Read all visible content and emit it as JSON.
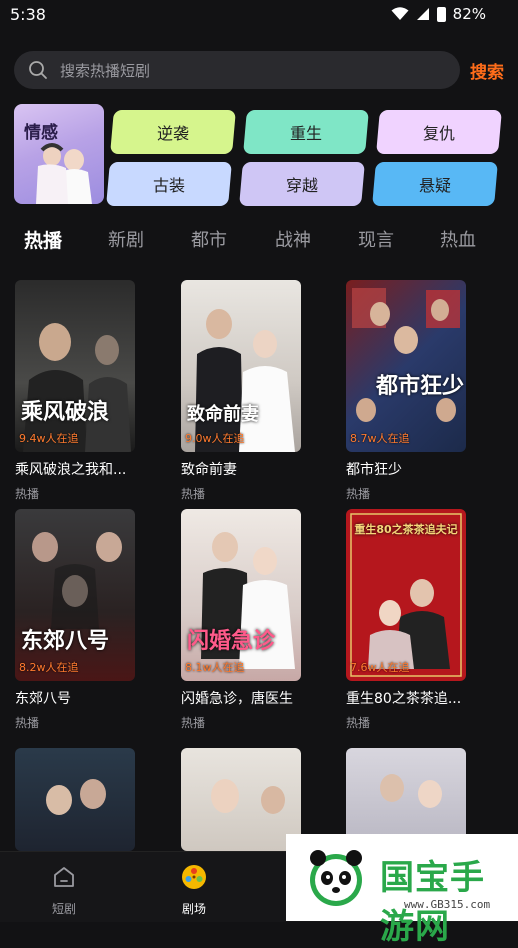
{
  "status_bar": {
    "time": "5:38",
    "battery": "82%"
  },
  "search": {
    "placeholder": "搜索热播短剧",
    "button_label": "搜索"
  },
  "featured": {
    "label": "情感"
  },
  "genres": [
    "逆袭",
    "重生",
    "复仇",
    "古装",
    "穿越",
    "悬疑"
  ],
  "genre_colors": [
    "#d6f58d",
    "#7fe6c6",
    "#f0d3ff",
    "#c8d9ff",
    "#cfc6f5",
    "#58b8f5"
  ],
  "tabs": [
    "热播",
    "新剧",
    "都市",
    "战神",
    "现言",
    "热血"
  ],
  "active_tab": "热播",
  "dramas": [
    {
      "title": "乘风破浪之我和...",
      "tag": "热播",
      "followers": "9.4w人在追",
      "poster_text": "乘风破浪"
    },
    {
      "title": "致命前妻",
      "tag": "热播",
      "followers": "9.0w人在追",
      "poster_text": "致命前妻"
    },
    {
      "title": "都市狂少",
      "tag": "热播",
      "followers": "8.7w人在追",
      "poster_text": "都市狂少"
    },
    {
      "title": "东郊八号",
      "tag": "热播",
      "followers": "8.2w人在追",
      "poster_text": "东郊八号"
    },
    {
      "title": "闪婚急诊，唐医生",
      "tag": "热播",
      "followers": "8.1w人在追",
      "poster_text": "闪婚急诊"
    },
    {
      "title": "重生80之茶茶追...",
      "tag": "热播",
      "followers": "7.6w人在追",
      "poster_text": "重生80之茶茶追夫记"
    }
  ],
  "bottom_nav": [
    {
      "label": "短剧",
      "icon": "home-icon"
    },
    {
      "label": "剧场",
      "icon": "film-reel-icon"
    }
  ],
  "watermark": {
    "text": "国宝手游网",
    "url": "www.GB315.com"
  }
}
